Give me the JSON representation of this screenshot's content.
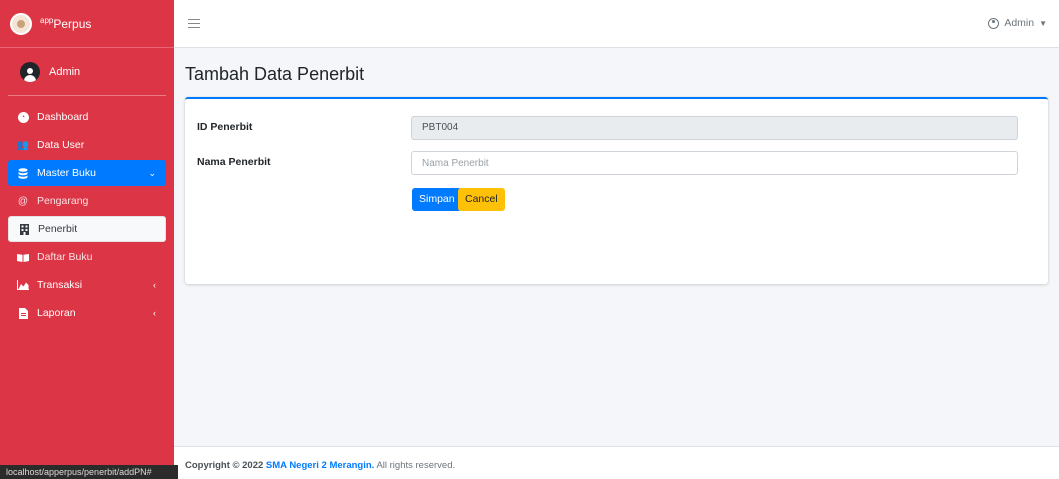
{
  "brand": {
    "sup": "app",
    "name": "Perpus"
  },
  "user_panel": {
    "name": "Admin"
  },
  "sidebar": {
    "items": [
      {
        "label": "Dashboard"
      },
      {
        "label": "Data User"
      },
      {
        "label": "Master Buku"
      },
      {
        "label": "Pengarang"
      },
      {
        "label": "Penerbit"
      },
      {
        "label": "Daftar Buku"
      },
      {
        "label": "Transaksi"
      },
      {
        "label": "Laporan"
      }
    ]
  },
  "topbar": {
    "user_label": "Admin"
  },
  "page": {
    "title": "Tambah Data Penerbit"
  },
  "form": {
    "id_label": "ID Penerbit",
    "id_value": "PBT004",
    "name_label": "Nama Penerbit",
    "name_placeholder": "Nama Penerbit",
    "save_label": "Simpan",
    "cancel_label": "Cancel"
  },
  "footer": {
    "prefix": "Copyright © 2022 ",
    "org": "SMA Negeri 2 Merangin.",
    "suffix": " All rights reserved."
  },
  "status_bar": {
    "url": "localhost/apperpus/penerbit/addPN#"
  }
}
